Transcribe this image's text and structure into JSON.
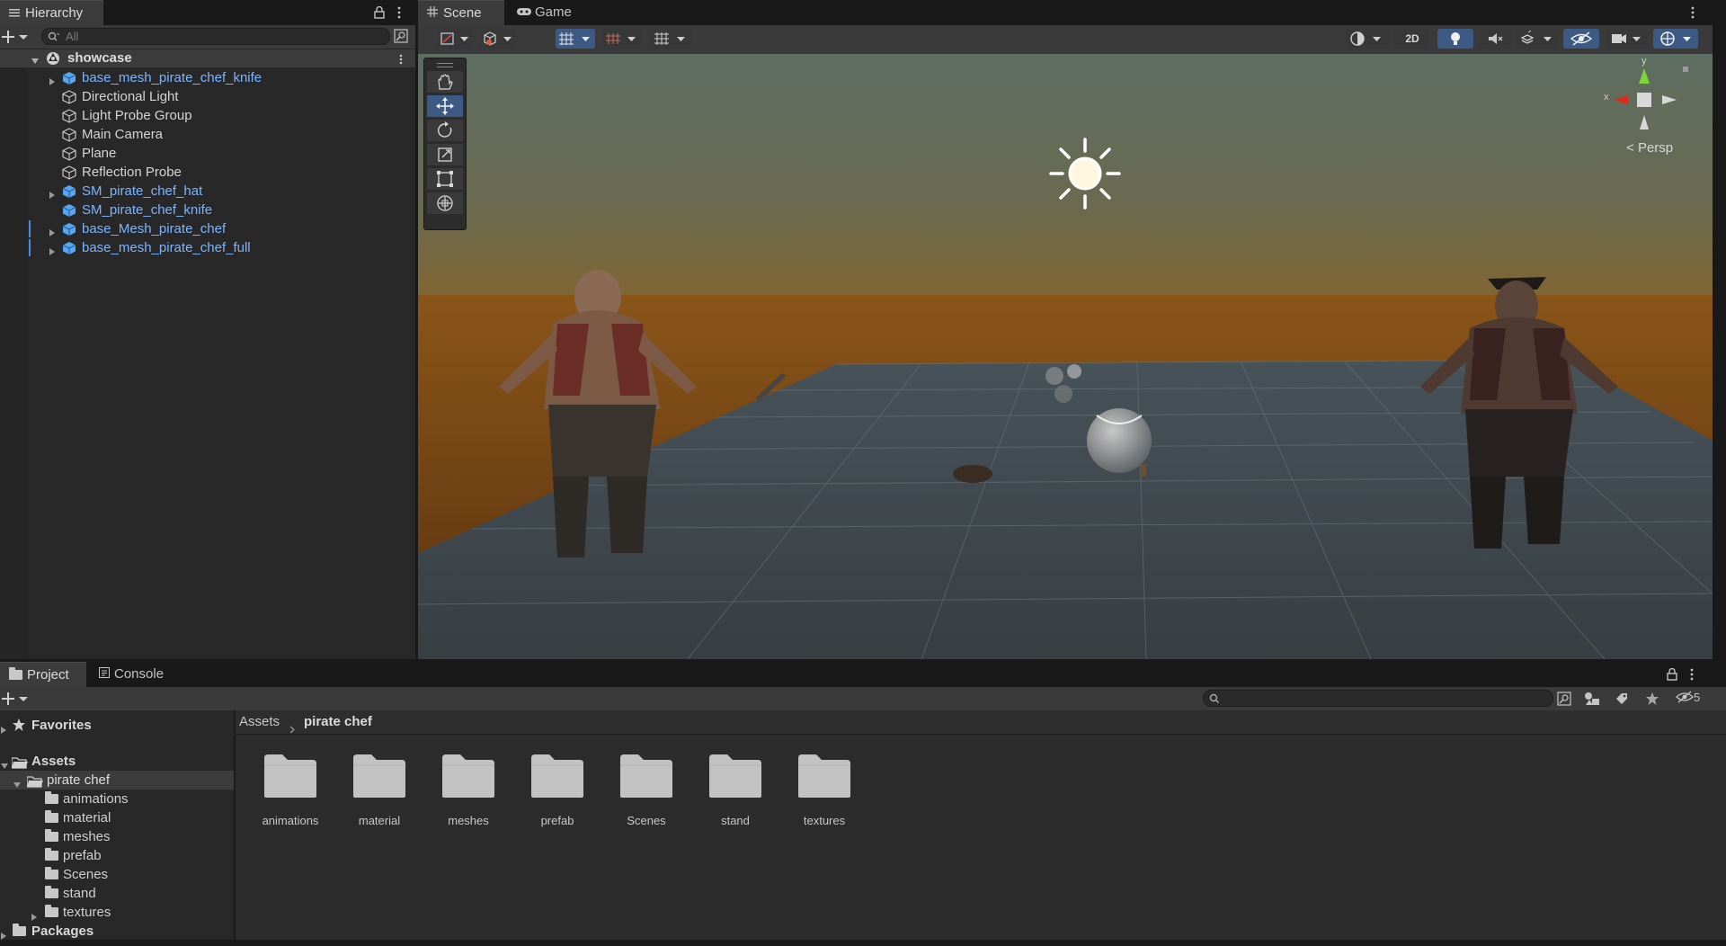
{
  "hierarchy": {
    "tab_label": "Hierarchy",
    "search_placeholder": "All",
    "scene_name": "showcase",
    "items": [
      {
        "label": "base_mesh_pirate_chef_knife",
        "prefab": true,
        "expandable": true
      },
      {
        "label": "Directional Light",
        "prefab": false,
        "expandable": false
      },
      {
        "label": "Light Probe Group",
        "prefab": false,
        "expandable": false
      },
      {
        "label": "Main Camera",
        "prefab": false,
        "expandable": false
      },
      {
        "label": "Plane",
        "prefab": false,
        "expandable": false
      },
      {
        "label": "Reflection Probe",
        "prefab": false,
        "expandable": false
      },
      {
        "label": "SM_pirate_chef_hat",
        "prefab": true,
        "expandable": true
      },
      {
        "label": "SM_pirate_chef_knife",
        "prefab": true,
        "expandable": false
      },
      {
        "label": "base_Mesh_pirate_chef",
        "prefab": true,
        "expandable": true
      },
      {
        "label": "base_mesh_pirate_chef_full",
        "prefab": true,
        "expandable": true
      }
    ]
  },
  "scene_view": {
    "tabs": [
      "Scene",
      "Game"
    ],
    "toolbar_2d_label": "2D",
    "gizmo_axes": {
      "y": "y",
      "x": "x"
    },
    "persp_label": "Persp",
    "tools": [
      "hand-tool",
      "move-tool",
      "rotate-tool",
      "scale-tool",
      "rect-tool",
      "transform-tool"
    ]
  },
  "project": {
    "tabs": [
      "Project",
      "Console"
    ],
    "hidden_count": "5",
    "favorites_label": "Favorites",
    "assets_label": "Assets",
    "packages_label": "Packages",
    "tree": {
      "root": "pirate chef",
      "children": [
        "animations",
        "material",
        "meshes",
        "prefab",
        "Scenes",
        "stand",
        "textures"
      ]
    },
    "breadcrumb": [
      "Assets",
      "pirate chef"
    ],
    "folders": [
      "animations",
      "material",
      "meshes",
      "prefab",
      "Scenes",
      "stand",
      "textures"
    ]
  },
  "colors": {
    "accent": "#3d5a84",
    "prefab_text": "#7cb4ff",
    "panel_bg": "#282828",
    "scene_sky_top": "#5f6f63",
    "scene_horizon": "#a4661d",
    "ground_plane": "#3c474d"
  }
}
